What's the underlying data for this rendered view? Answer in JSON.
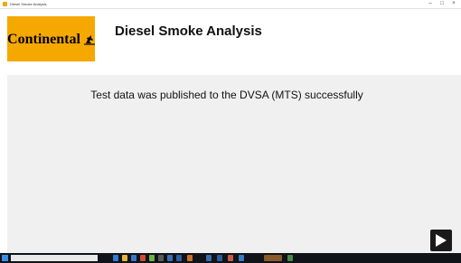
{
  "window": {
    "title": "Diesel Smoke Analysis",
    "minimize_glyph": "–",
    "maximize_glyph": "□",
    "close_glyph": "×"
  },
  "header": {
    "logo_text": "Continental",
    "logo_icon": "horse-icon",
    "title": "Diesel Smoke Analysis"
  },
  "main": {
    "message": "Test data was published to the DVSA (MTS) successfully",
    "next_button_icon": "play-icon"
  },
  "colors": {
    "brand": "#f5a800",
    "content_bg": "#f0f0f0",
    "button_bg": "#1a1a1a",
    "taskbar_bg": "#101318"
  },
  "taskbar": {
    "icons": [
      "browser-icon",
      "folder-icon",
      "mail-icon",
      "app-icon",
      "app-icon",
      "app-icon",
      "app-icon",
      "app-icon",
      "app-icon",
      "app-icon",
      "app-icon",
      "app-icon",
      "app-icon",
      "app-icon",
      "app-icon"
    ]
  }
}
